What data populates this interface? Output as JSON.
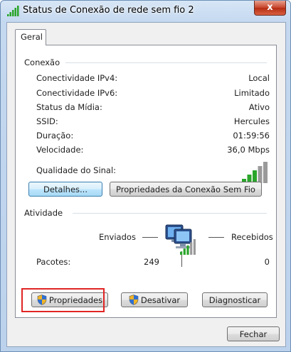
{
  "window": {
    "title": "Status de Conexão de rede sem fio 2",
    "close_glyph": "x"
  },
  "tab": {
    "label": "Geral"
  },
  "connection": {
    "header": "Conexão",
    "rows": [
      {
        "label": "Conectividade IPv4:",
        "value": "Local"
      },
      {
        "label": "Conectividade IPv6:",
        "value": "Limitado"
      },
      {
        "label": "Status da Mídia:",
        "value": "Ativo"
      },
      {
        "label": "SSID:",
        "value": "Hercules"
      },
      {
        "label": "Duração:",
        "value": "01:59:56"
      },
      {
        "label": "Velocidade:",
        "value": "36,0 Mbps"
      }
    ],
    "signal_label": "Qualidade do Sinal:",
    "signal_bars_lit": 3,
    "signal_bars_total": 5,
    "details_button": "Detalhes...",
    "wireless_props_button": "Propriedades da Conexão Sem Fio"
  },
  "activity": {
    "header": "Atividade",
    "sent_label": "Enviados",
    "received_label": "Recebidos",
    "packets_label": "Pacotes:",
    "packets_sent": "249",
    "packets_received": "0"
  },
  "buttons": {
    "properties": "Propriedades",
    "disable": "Desativar",
    "diagnose": "Diagnosticar",
    "close": "Fechar"
  },
  "colors": {
    "highlight_box": "#e02424",
    "signal_lit": "#2aa52a",
    "signal_dim": "#9a9a9a"
  }
}
